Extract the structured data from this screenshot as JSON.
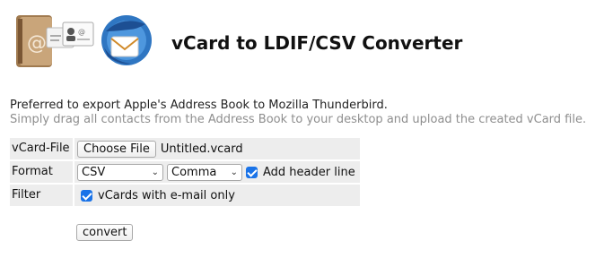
{
  "header": {
    "title": "vCard to LDIF/CSV Converter",
    "logo_icon": "address-book-to-thunderbird-logo"
  },
  "intro": {
    "line1": "Preferred to export Apple's Address Book to Mozilla Thunderbird.",
    "line2": "Simply drag all contacts from the Address Book to your desktop and upload the created vCard file."
  },
  "form": {
    "vcard_file": {
      "label": "vCard-File",
      "button": "Choose File",
      "filename": "Untitled.vcard"
    },
    "format": {
      "label": "Format",
      "format_value": "CSV",
      "delimiter_value": "Comma",
      "header_line_label": "Add header line",
      "header_line_checked": true
    },
    "filter": {
      "label": "Filter",
      "email_only_label": "vCards with e-mail only",
      "email_only_checked": true
    },
    "submit": "convert"
  },
  "colors": {
    "accent": "#1a73e8",
    "row_background": "#ededed",
    "sub_text": "#8e8e8e"
  }
}
